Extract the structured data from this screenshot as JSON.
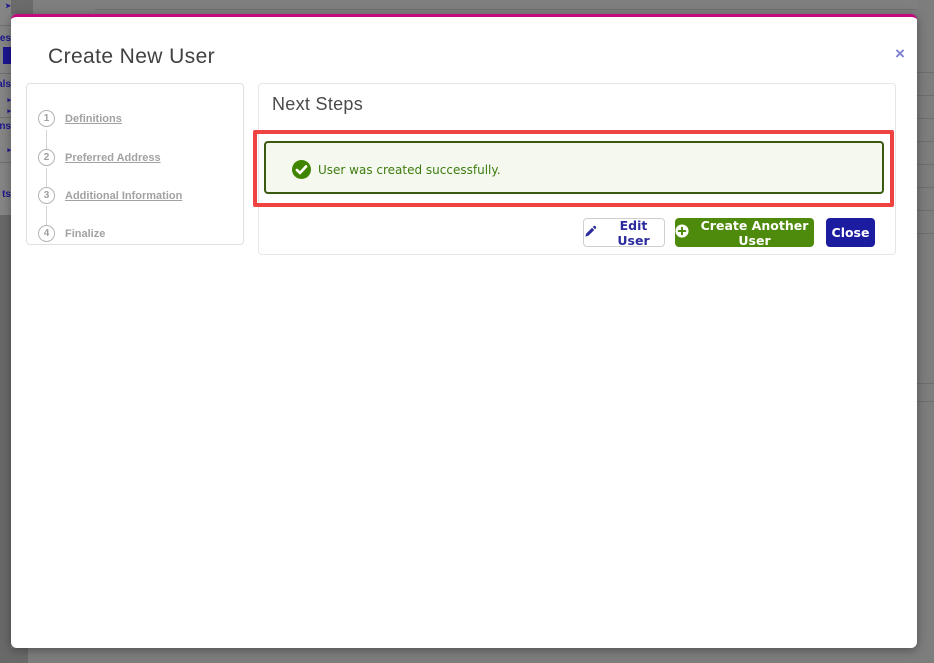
{
  "modal": {
    "title": "Create New User",
    "close_icon": "×"
  },
  "wizard": {
    "steps": [
      {
        "number": "1",
        "label": "Definitions"
      },
      {
        "number": "2",
        "label": "Preferred Address"
      },
      {
        "number": "3",
        "label": "Additional Information"
      },
      {
        "number": "4",
        "label": "Finalize"
      }
    ]
  },
  "panel": {
    "title": "Next Steps",
    "alert": {
      "message": "User was created successfully."
    },
    "buttons": {
      "edit": "Edit User",
      "create_another": "Create Another User",
      "close": "Close"
    }
  },
  "background": {
    "left_fragments": {
      "0": "es",
      "1": "als",
      "2": "ns",
      "3": "ts"
    }
  },
  "colors": {
    "modal_top_border": "#c4087e",
    "highlight_annotation": "#ee4340",
    "alert_border": "#3a5a10",
    "alert_background": "#f4f8ee",
    "alert_green": "#3e7c0f",
    "button_success": "#4e8a0b",
    "button_primary_navy": "#1c1ca0",
    "secondary_text_navy": "#2b2b9d",
    "close_x_purple": "#7d81d2",
    "overlay_gray": "#7d7d7d"
  }
}
